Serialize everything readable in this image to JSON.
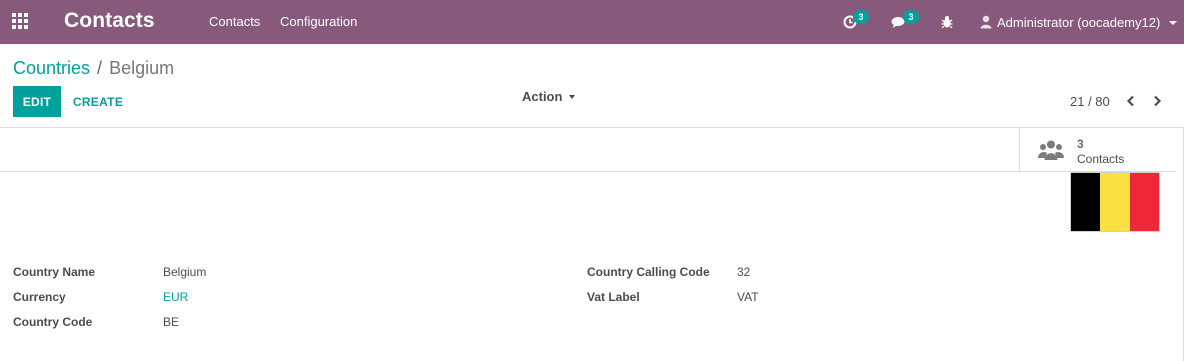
{
  "navbar": {
    "app_title": "Contacts",
    "menu": [
      {
        "label": "Contacts"
      },
      {
        "label": "Configuration"
      }
    ],
    "activity_count": "3",
    "messages_count": "3",
    "user_label": "Administrator (oocademy12)",
    "icons": {
      "apps": "apps-grid-icon",
      "activity": "clock-icon",
      "messages": "comments-icon",
      "debug": "bug-icon",
      "user": "user-icon"
    },
    "background_color": "#875a7b"
  },
  "breadcrumb": {
    "parent": "Countries",
    "separator": "/",
    "current": "Belgium"
  },
  "buttons": {
    "edit": "EDIT",
    "create": "CREATE",
    "action": "Action"
  },
  "pager": {
    "value": "21 / 80"
  },
  "stat_button": {
    "value": "3",
    "label": "Contacts",
    "icon": "users-icon"
  },
  "flag": {
    "country": "Belgium",
    "colors": [
      "#000000",
      "#fae042",
      "#ed2939"
    ]
  },
  "fields_left": [
    {
      "label": "Country Name",
      "value": "Belgium",
      "link": false
    },
    {
      "label": "Currency",
      "value": "EUR",
      "link": true
    },
    {
      "label": "Country Code",
      "value": "BE",
      "link": false
    }
  ],
  "fields_right": [
    {
      "label": "Country Calling Code",
      "value": "32",
      "link": false
    },
    {
      "label": "Vat Label",
      "value": "VAT",
      "link": false
    }
  ],
  "accent_color": "#00a09d"
}
